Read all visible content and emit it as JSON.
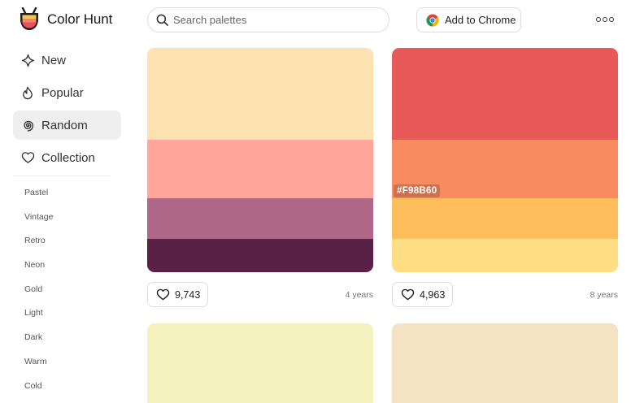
{
  "app": {
    "name": "Color Hunt",
    "logo_colors": {
      "top": "#f6c453",
      "middle": "#f4836b",
      "bottom": "#e8505b",
      "outline": "#1f1f1f"
    }
  },
  "search": {
    "placeholder": "Search palettes"
  },
  "header": {
    "chrome_button_label": "Add to Chrome",
    "more_icon": "more-dots-icon"
  },
  "sidebar": {
    "nav": [
      {
        "label": "New",
        "icon": "sparkle-icon",
        "active": false
      },
      {
        "label": "Popular",
        "icon": "flame-icon",
        "active": false
      },
      {
        "label": "Random",
        "icon": "spiral-icon",
        "active": true
      },
      {
        "label": "Collection",
        "icon": "heart-icon",
        "active": false
      }
    ],
    "tags": [
      "Pastel",
      "Vintage",
      "Retro",
      "Neon",
      "Gold",
      "Light",
      "Dark",
      "Warm",
      "Cold"
    ]
  },
  "palettes": [
    {
      "colors": [
        "#FDE2B1",
        "#FFA59A",
        "#AF6787",
        "#5A2147"
      ],
      "likes": "9,743",
      "age": "4 years",
      "hover_label": ""
    },
    {
      "colors": [
        "#E85A5A",
        "#F98B60",
        "#FFBE5C",
        "#FFDD85"
      ],
      "likes": "4,963",
      "age": "8 years",
      "hover_label": "#F98B60"
    },
    {
      "colors": [
        "#F5F2C0"
      ],
      "likes": "",
      "age": "",
      "hover_label": ""
    },
    {
      "colors": [
        "#F4E3C3"
      ],
      "likes": "",
      "age": "",
      "hover_label": ""
    }
  ]
}
